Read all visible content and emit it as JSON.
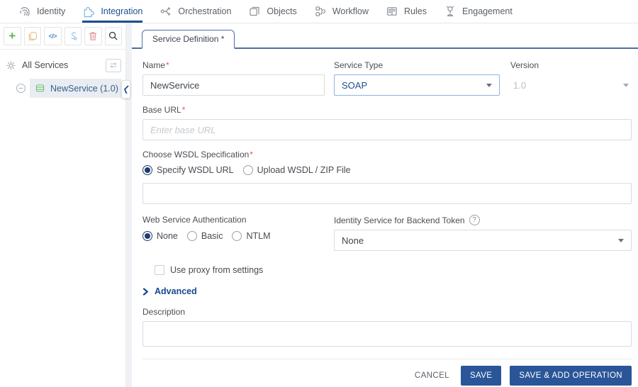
{
  "nav": {
    "items": [
      {
        "label": "Identity"
      },
      {
        "label": "Integration"
      },
      {
        "label": "Orchestration"
      },
      {
        "label": "Objects"
      },
      {
        "label": "Workflow"
      },
      {
        "label": "Rules"
      },
      {
        "label": "Engagement"
      }
    ],
    "active": "Integration"
  },
  "sidebar": {
    "toolbar_icons": [
      "add",
      "copy",
      "code",
      "import",
      "delete",
      "search"
    ],
    "all_services_label": "All Services",
    "service_item_label": "NewService (1.0)"
  },
  "main": {
    "tab_label": "Service Definition *",
    "form": {
      "name": {
        "label": "Name",
        "required_mark": "*",
        "value": "NewService"
      },
      "service_type": {
        "label": "Service Type",
        "value": "SOAP"
      },
      "version": {
        "label": "Version",
        "value": "1.0"
      },
      "base_url": {
        "label": "Base URL",
        "required_mark": "*",
        "placeholder": "Enter base URL",
        "value": ""
      },
      "wsdl_spec": {
        "label": "Choose WSDL Specification",
        "required_mark": "*",
        "options": [
          "Specify WSDL URL",
          "Upload WSDL / ZIP File"
        ],
        "selected": "Specify WSDL URL",
        "url_value": ""
      },
      "web_service_auth": {
        "label": "Web Service Authentication",
        "options": [
          "None",
          "Basic",
          "NTLM"
        ],
        "selected": "None"
      },
      "identity_service": {
        "label": "Identity Service for Backend Token",
        "help_glyph": "?",
        "value": "None"
      },
      "proxy_checkbox": {
        "label": "Use proxy from settings",
        "checked": false
      },
      "advanced": {
        "label": "Advanced"
      },
      "description": {
        "label": "Description",
        "value": ""
      }
    },
    "footer": {
      "cancel": "CANCEL",
      "save": "SAVE",
      "save_add": "SAVE & ADD OPERATION"
    }
  },
  "glyphs": {
    "add": "+",
    "code": "</>"
  },
  "colors": {
    "accent_navy": "#1d4e8f",
    "button_navy": "#2a5699",
    "active_icon_blue": "#7fb2e5",
    "tab_line": "#4f6f9e",
    "selected_row_bg": "#e9edf1",
    "required_red": "#e25a4a",
    "add_green": "#5cb85c",
    "copy_tan": "#eac287",
    "delete_red": "#df9191"
  }
}
